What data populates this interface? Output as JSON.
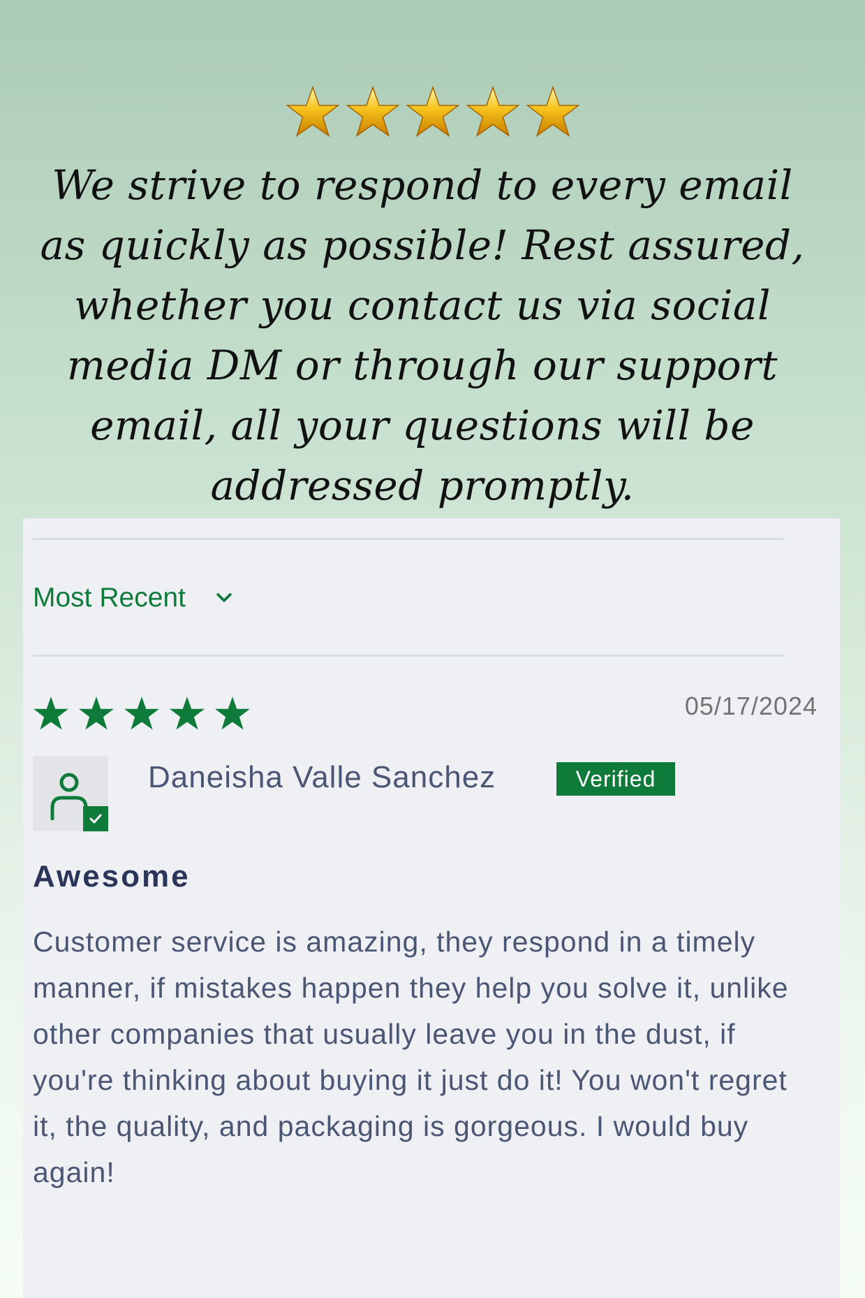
{
  "hero": {
    "star_count": 5,
    "star_icon": "gold-star-icon",
    "message": "We strive to respond to every email as quickly as possible! Rest assured, whether you contact us via social media DM or through our support email, all your questions will be addressed promptly."
  },
  "reviews": {
    "sort": {
      "selected": "Most Recent",
      "icon": "chevron-down-icon"
    },
    "items": [
      {
        "rating": 5,
        "date": "05/17/2024",
        "author": "Daneisha Valle Sanchez",
        "badge": "Verified",
        "avatar_icon": "user-icon",
        "title": "Awesome",
        "body": "Customer service is amazing, they respond in a timely manner, if mistakes happen they help you solve it, unlike other companies that usually leave you in the dust, if you're thinking about buying it just do it! You won't regret it, the quality, and packaging is gorgeous. I would buy again!"
      }
    ]
  },
  "colors": {
    "accent_green": "#0f7b3a",
    "text_slate": "#4b5674",
    "title_navy": "#2b3559",
    "card_bg": "#eef0f4",
    "star_gold": "#f4b400"
  }
}
